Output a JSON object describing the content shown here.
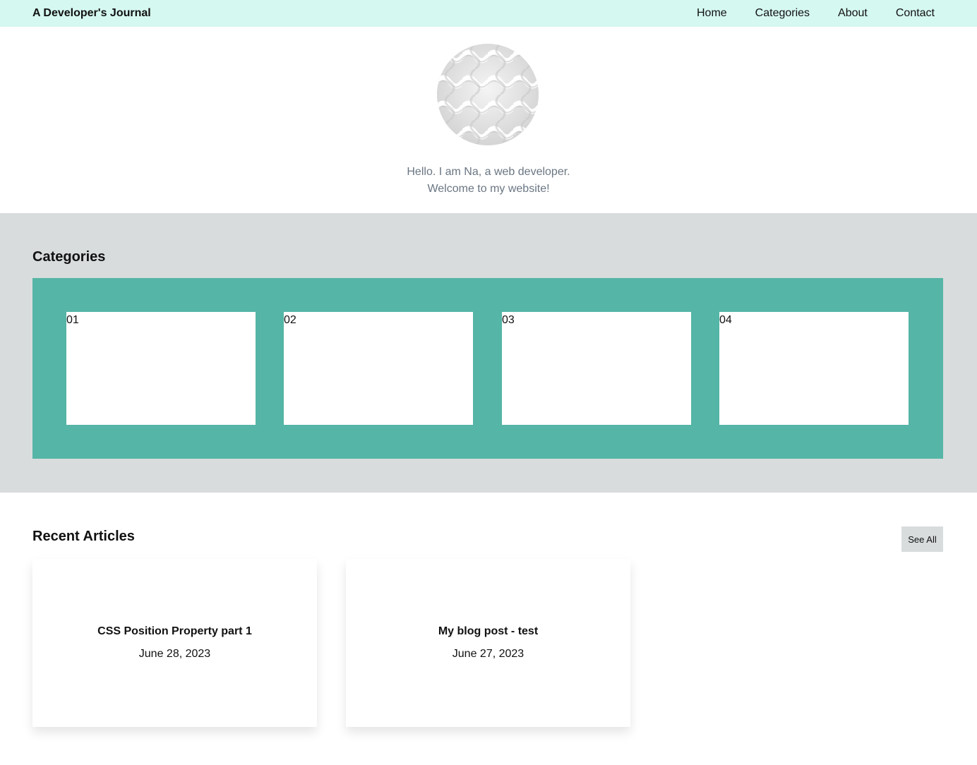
{
  "header": {
    "brand": "A Developer's Journal",
    "nav": [
      "Home",
      "Categories",
      "About",
      "Contact"
    ]
  },
  "hero": {
    "avatar_icon": "woven-pattern-avatar",
    "line1": "Hello. I am Na, a web developer.",
    "line2": "Welcome to my website!"
  },
  "categories": {
    "title": "Categories",
    "items": [
      "01",
      "02",
      "03",
      "04"
    ]
  },
  "recent": {
    "title": "Recent Articles",
    "see_all": "See All",
    "articles": [
      {
        "title": "CSS Position Property part 1",
        "date": "June 28, 2023"
      },
      {
        "title": "My blog post - test",
        "date": "June 27, 2023"
      }
    ]
  },
  "colors": {
    "header_bg": "#d5f8f0",
    "section_bg": "#d8dcdd",
    "accent": "#55b5a6"
  }
}
